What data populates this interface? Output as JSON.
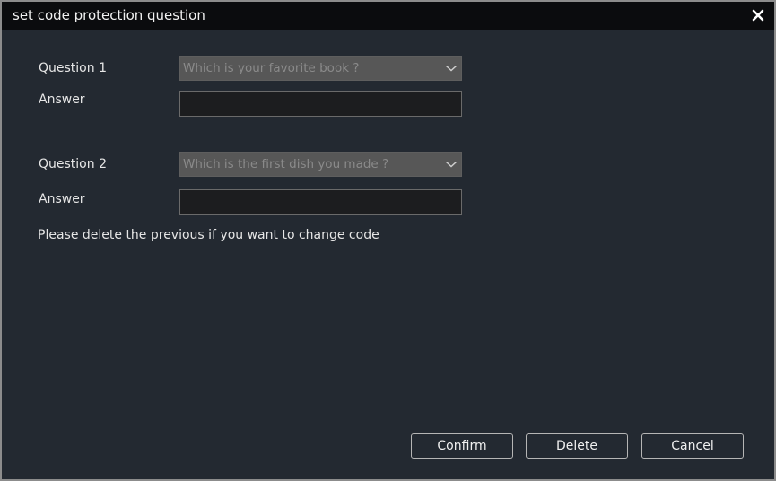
{
  "dialog": {
    "title": "set code protection question",
    "close_icon": "close-icon"
  },
  "question1": {
    "label": "Question 1",
    "selected": "Which is your favorite book ?",
    "answer_label": "Answer",
    "answer_value": ""
  },
  "question2": {
    "label": "Question 2",
    "selected": "Which is the first dish you made ?",
    "answer_label": "Answer",
    "answer_value": ""
  },
  "note": "Please delete the previous if you want to change code",
  "buttons": {
    "confirm": "Confirm",
    "delete": "Delete",
    "cancel": "Cancel"
  },
  "colors": {
    "titlebar": "#0b0c0e",
    "panel": "#232931",
    "select_bg": "#575757",
    "input_bg": "#1c1d1f"
  }
}
